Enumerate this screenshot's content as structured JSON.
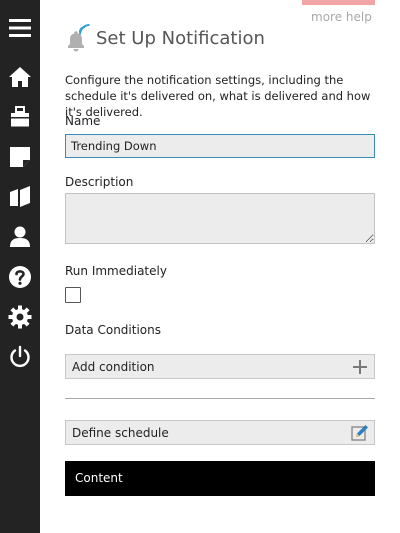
{
  "sidebar": {
    "items": [
      {
        "icon": "menu-icon"
      },
      {
        "icon": "home-icon"
      },
      {
        "icon": "briefcase-icon"
      },
      {
        "icon": "note-icon"
      },
      {
        "icon": "book-icon"
      },
      {
        "icon": "user-icon"
      },
      {
        "icon": "help-icon"
      },
      {
        "icon": "gear-icon"
      },
      {
        "icon": "power-icon"
      }
    ],
    "background": "#232323",
    "icon_color": "#ffffff"
  },
  "header": {
    "more_help": "more help",
    "title": "Set Up Notification",
    "icon": "bell-icon",
    "accent_color": "#f3a5a5",
    "signal_color": "#2e9fd6"
  },
  "intro": "Configure the notification settings, including the schedule it's delivered on, what is delivered and how it's delivered.",
  "form": {
    "name": {
      "label": "Name",
      "value": "Trending Down"
    },
    "description": {
      "label": "Description",
      "value": ""
    },
    "run_immediately": {
      "label": "Run Immediately",
      "checked": false
    },
    "data_conditions": {
      "label": "Data Conditions",
      "add_label": "Add condition",
      "add_icon": "plus-icon"
    },
    "schedule": {
      "label": "Define schedule",
      "icon": "edit-icon"
    },
    "content": {
      "label": "Content"
    }
  },
  "colors": {
    "field_bg": "#ececec",
    "focus_border": "#3a8db8",
    "content_bg": "#000000"
  }
}
